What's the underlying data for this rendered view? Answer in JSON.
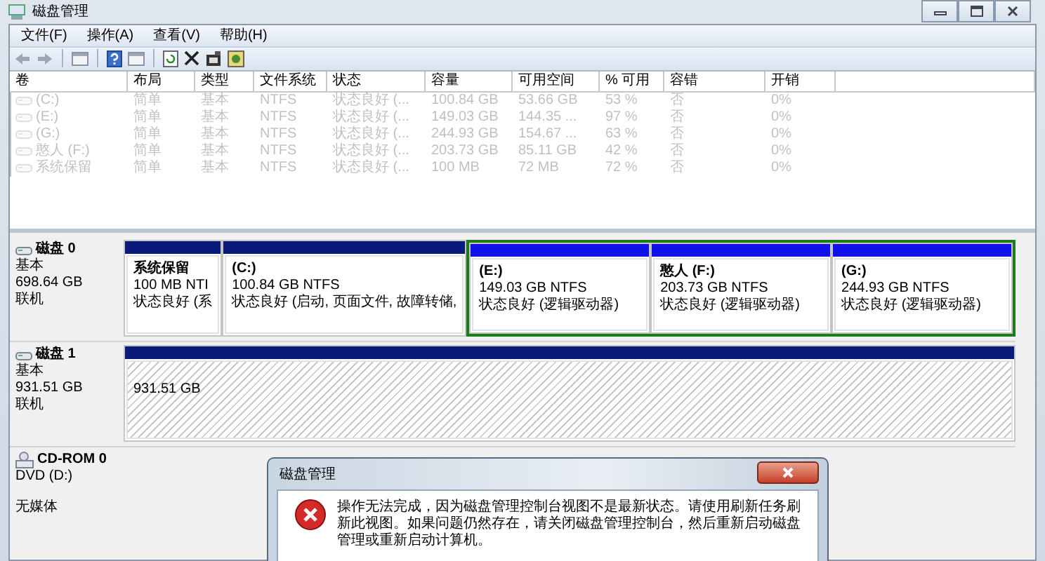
{
  "window": {
    "title": "磁盘管理"
  },
  "menu": [
    "文件(F)",
    "操作(A)",
    "查看(V)",
    "帮助(H)"
  ],
  "volume_table": {
    "columns": [
      "卷",
      "布局",
      "类型",
      "文件系统",
      "状态",
      "容量",
      "可用空间",
      "% 可用",
      "容错",
      "开销"
    ],
    "rows": [
      {
        "cells": [
          "(C:)",
          "简单",
          "基本",
          "NTFS",
          "状态良好 (...",
          "100.84 GB",
          "53.66 GB",
          "53 %",
          "否",
          "0%"
        ]
      },
      {
        "cells": [
          "(E:)",
          "简单",
          "基本",
          "NTFS",
          "状态良好 (...",
          "149.03 GB",
          "144.35 ...",
          "97 %",
          "否",
          "0%"
        ]
      },
      {
        "cells": [
          "(G:)",
          "简单",
          "基本",
          "NTFS",
          "状态良好 (...",
          "244.93 GB",
          "154.67 ...",
          "63 %",
          "否",
          "0%"
        ]
      },
      {
        "cells": [
          "憨人 (F:)",
          "简单",
          "基本",
          "NTFS",
          "状态良好 (...",
          "203.73 GB",
          "85.11 GB",
          "42 %",
          "否",
          "0%"
        ]
      },
      {
        "cells": [
          "系统保留",
          "简单",
          "基本",
          "NTFS",
          "状态良好 (...",
          "100 MB",
          "72 MB",
          "72 %",
          "否",
          "0%"
        ]
      }
    ]
  },
  "disks": [
    {
      "kind": "disk",
      "name": "磁盘 0",
      "lines": [
        "基本",
        "698.64 GB",
        "联机"
      ],
      "partitions": [
        {
          "kind": "primary",
          "title": "系统保留",
          "lines": [
            "100 MB NTI",
            "状态良好 (系"
          ]
        },
        {
          "kind": "primary",
          "title": "(C:)",
          "lines": [
            "100.84 GB NTFS",
            "状态良好 (启动, 页面文件, 故障转储,"
          ]
        },
        {
          "kind": "extended",
          "children": [
            {
              "kind": "logical",
              "title": "(E:)",
              "lines": [
                "149.03 GB NTFS",
                "状态良好 (逻辑驱动器)"
              ]
            },
            {
              "kind": "logical",
              "title": "憨人  (F:)",
              "lines": [
                "203.73 GB NTFS",
                "状态良好 (逻辑驱动器)"
              ]
            },
            {
              "kind": "logical",
              "title": "(G:)",
              "lines": [
                "244.93 GB NTFS",
                "状态良好 (逻辑驱动器)"
              ]
            }
          ]
        }
      ]
    },
    {
      "kind": "disk",
      "name": "磁盘 1",
      "lines": [
        "基本",
        "931.51 GB",
        "联机"
      ],
      "partitions": [
        {
          "kind": "unallocated",
          "lines": [
            "931.51 GB"
          ]
        }
      ]
    },
    {
      "kind": "cdrom",
      "name": "CD-ROM 0",
      "lines": [
        "DVD (D:)",
        "无媒体"
      ]
    }
  ],
  "dialog": {
    "title": "磁盘管理",
    "message": "操作无法完成，因为磁盘管理控制台视图不是最新状态。请使用刷新任务刷新此视图。如果问题仍然存在，请关闭磁盘管理控制台，然后重新启动磁盘管理或重新启动计算机。"
  }
}
